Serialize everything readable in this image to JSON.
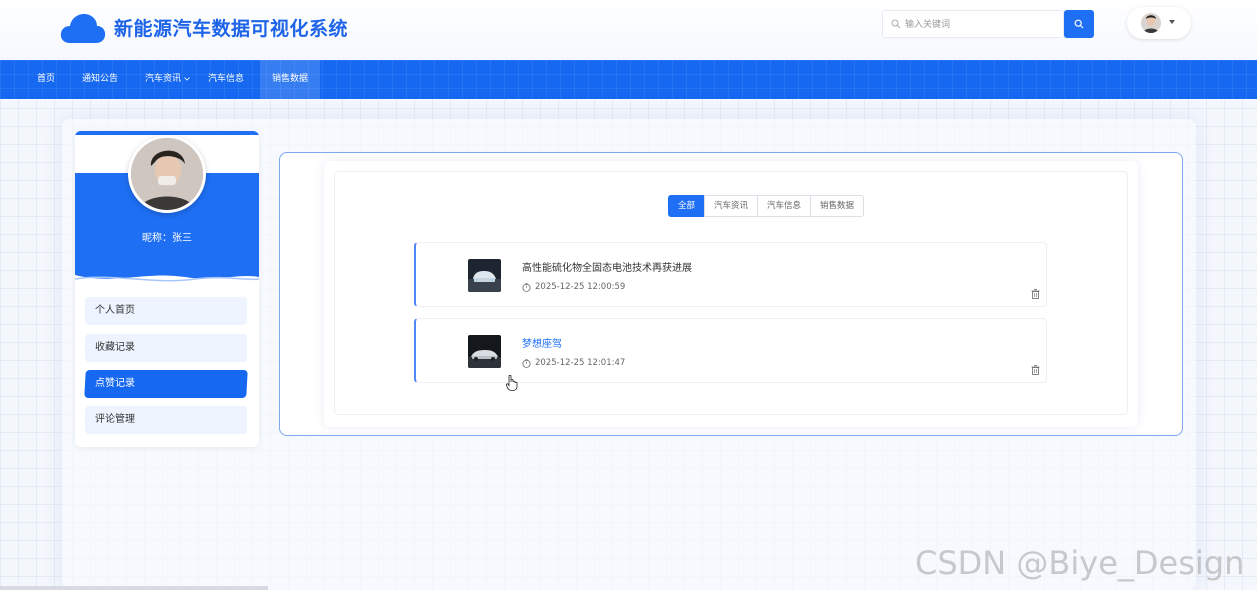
{
  "header": {
    "title": "新能源汽车数据可视化系统",
    "search_placeholder": "输入关键词"
  },
  "nav": {
    "items": [
      {
        "label": "首页"
      },
      {
        "label": "通知公告"
      },
      {
        "label": "汽车资讯"
      },
      {
        "label": "汽车信息"
      },
      {
        "label": "销售数据",
        "active": true
      }
    ]
  },
  "profile": {
    "nickname_label": "昵称：",
    "nickname": "张三"
  },
  "sidebar": {
    "items": [
      {
        "label": "个人首页"
      },
      {
        "label": "收藏记录"
      },
      {
        "label": "点赞记录",
        "active": true
      },
      {
        "label": "评论管理"
      }
    ]
  },
  "filter_tabs": [
    {
      "label": "全部",
      "active": true
    },
    {
      "label": "汽车资讯"
    },
    {
      "label": "汽车信息"
    },
    {
      "label": "销售数据"
    }
  ],
  "records": [
    {
      "title": "高性能硫化物全固态电池技术再获进展",
      "time": "2025-12-25 12:00:59"
    },
    {
      "title": "梦想座驾",
      "time": "2025-12-25 12:01:47"
    }
  ],
  "watermark": "CSDN @Biye_Design",
  "colors": {
    "primary": "#1f6ff4",
    "nav_bg": "#1668f0"
  }
}
